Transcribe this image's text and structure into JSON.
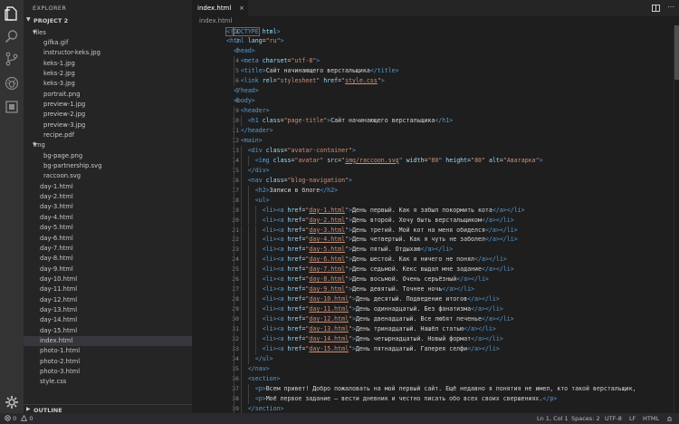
{
  "sidebar": {
    "title": "EXPLORER",
    "project": "PROJECT 2",
    "outline": "OUTLINE",
    "tree": [
      {
        "label": "files",
        "kind": "folder"
      },
      {
        "label": "gifka.gif",
        "kind": "file"
      },
      {
        "label": "instructor-keks.jpg",
        "kind": "file"
      },
      {
        "label": "keks-1.jpg",
        "kind": "file"
      },
      {
        "label": "keks-2.jpg",
        "kind": "file"
      },
      {
        "label": "keks-3.jpg",
        "kind": "file"
      },
      {
        "label": "portrait.png",
        "kind": "file"
      },
      {
        "label": "preview-1.jpg",
        "kind": "file"
      },
      {
        "label": "preview-2.jpg",
        "kind": "file"
      },
      {
        "label": "preview-3.jpg",
        "kind": "file"
      },
      {
        "label": "recipe.pdf",
        "kind": "file"
      },
      {
        "label": "img",
        "kind": "folder"
      },
      {
        "label": "bg-page.png",
        "kind": "file"
      },
      {
        "label": "bg-partnership.svg",
        "kind": "file"
      },
      {
        "label": "raccoon.svg",
        "kind": "file"
      },
      {
        "label": "day-1.html",
        "kind": "root"
      },
      {
        "label": "day-2.html",
        "kind": "root"
      },
      {
        "label": "day-3.html",
        "kind": "root"
      },
      {
        "label": "day-4.html",
        "kind": "root"
      },
      {
        "label": "day-5.html",
        "kind": "root"
      },
      {
        "label": "day-6.html",
        "kind": "root"
      },
      {
        "label": "day-7.html",
        "kind": "root"
      },
      {
        "label": "day-8.html",
        "kind": "root"
      },
      {
        "label": "day-9.html",
        "kind": "root"
      },
      {
        "label": "day-10.html",
        "kind": "root"
      },
      {
        "label": "day-11.html",
        "kind": "root"
      },
      {
        "label": "day-12.html",
        "kind": "root"
      },
      {
        "label": "day-13.html",
        "kind": "root"
      },
      {
        "label": "day-14.html",
        "kind": "root"
      },
      {
        "label": "day-15.html",
        "kind": "root"
      },
      {
        "label": "index.html",
        "kind": "root",
        "selected": true
      },
      {
        "label": "photo-1.html",
        "kind": "root"
      },
      {
        "label": "photo-2.html",
        "kind": "root"
      },
      {
        "label": "photo-3.html",
        "kind": "root"
      },
      {
        "label": "style.css",
        "kind": "root"
      }
    ]
  },
  "editor": {
    "tab_label": "index.html",
    "close_glyph": "×",
    "breadcrumb": "index.html",
    "lines": [
      [
        [
          "<!",
          "t"
        ],
        [
          "DOCTYPE",
          "t"
        ],
        [
          " html",
          "a"
        ],
        [
          ">",
          "t"
        ]
      ],
      [
        [
          "<html",
          "t"
        ],
        [
          " lang",
          "a"
        ],
        [
          "=",
          "p"
        ],
        [
          "\"ru\"",
          "s"
        ],
        [
          ">",
          "t"
        ]
      ],
      [
        [
          "  "
        ],
        [
          "<head>",
          "t"
        ]
      ],
      [
        [
          "    "
        ],
        [
          "<meta",
          "t"
        ],
        [
          " charset",
          "a"
        ],
        [
          "=",
          "p"
        ],
        [
          "\"utf-8\"",
          "s"
        ],
        [
          ">",
          "t"
        ]
      ],
      [
        [
          "    "
        ],
        [
          "<title>",
          "t"
        ],
        [
          "Сайт начинающего верстальщика",
          "p"
        ],
        [
          "</title>",
          "t"
        ]
      ],
      [
        [
          "    "
        ],
        [
          "<link",
          "t"
        ],
        [
          " rel",
          "a"
        ],
        [
          "=",
          "p"
        ],
        [
          "\"stylesheet\"",
          "s"
        ],
        [
          " href",
          "a"
        ],
        [
          "=",
          "p"
        ],
        [
          "\"",
          "s"
        ],
        [
          "style.css",
          "u"
        ],
        [
          "\"",
          "s"
        ],
        [
          ">",
          "t"
        ]
      ],
      [
        [
          "  "
        ],
        [
          "</head>",
          "t"
        ]
      ],
      [
        [
          "  "
        ],
        [
          "<body>",
          "t"
        ]
      ],
      [
        [
          "    "
        ],
        [
          "<header>",
          "t"
        ]
      ],
      [
        [
          "      "
        ],
        [
          "<h1",
          "t"
        ],
        [
          " class",
          "a"
        ],
        [
          "=",
          "p"
        ],
        [
          "\"page-title\"",
          "s"
        ],
        [
          ">",
          "t"
        ],
        [
          "Сайт начинающего верстальщика",
          "p"
        ],
        [
          "</h1>",
          "t"
        ]
      ],
      [
        [
          "    "
        ],
        [
          "</header>",
          "t"
        ]
      ],
      [
        [
          "    "
        ],
        [
          "<main>",
          "t"
        ]
      ],
      [
        [
          "      "
        ],
        [
          "<div",
          "t"
        ],
        [
          " class",
          "a"
        ],
        [
          "=",
          "p"
        ],
        [
          "\"avatar-container\"",
          "s"
        ],
        [
          ">",
          "t"
        ]
      ],
      [
        [
          "        "
        ],
        [
          "<img",
          "t"
        ],
        [
          " class",
          "a"
        ],
        [
          "=",
          "p"
        ],
        [
          "\"avatar\"",
          "s"
        ],
        [
          " src",
          "a"
        ],
        [
          "=",
          "p"
        ],
        [
          "\"",
          "s"
        ],
        [
          "img/raccoon.svg",
          "u"
        ],
        [
          "\"",
          "s"
        ],
        [
          " width",
          "a"
        ],
        [
          "=",
          "p"
        ],
        [
          "\"80\"",
          "s"
        ],
        [
          " height",
          "a"
        ],
        [
          "=",
          "p"
        ],
        [
          "\"80\"",
          "s"
        ],
        [
          " alt",
          "a"
        ],
        [
          "=",
          "p"
        ],
        [
          "\"Аватарка\"",
          "s"
        ],
        [
          ">",
          "t"
        ]
      ],
      [
        [
          "      "
        ],
        [
          "</div>",
          "t"
        ]
      ],
      [
        [
          "      "
        ],
        [
          "<nav",
          "t"
        ],
        [
          " class",
          "a"
        ],
        [
          "=",
          "p"
        ],
        [
          "\"blog-navigation\"",
          "s"
        ],
        [
          ">",
          "t"
        ]
      ],
      [
        [
          "        "
        ],
        [
          "<h2>",
          "t"
        ],
        [
          "Записи в блоге",
          "p"
        ],
        [
          "</h2>",
          "t"
        ]
      ],
      [
        [
          "        "
        ],
        [
          "<ul>",
          "t"
        ]
      ],
      [
        [
          "          "
        ],
        [
          "<li>",
          "t"
        ],
        [
          "<a",
          "t"
        ],
        [
          " href",
          "a"
        ],
        [
          "=",
          "p"
        ],
        [
          "\"",
          "s"
        ],
        [
          "day-1.html",
          "u"
        ],
        [
          "\"",
          "s"
        ],
        [
          ">",
          "t"
        ],
        [
          "День первый. Как я забыл покормить кота",
          "p"
        ],
        [
          "</a></li>",
          "t"
        ]
      ],
      [
        [
          "          "
        ],
        [
          "<li>",
          "t"
        ],
        [
          "<a",
          "t"
        ],
        [
          " href",
          "a"
        ],
        [
          "=",
          "p"
        ],
        [
          "\"",
          "s"
        ],
        [
          "day-2.html",
          "u"
        ],
        [
          "\"",
          "s"
        ],
        [
          ">",
          "t"
        ],
        [
          "День второй. Хочу быть верстальщиком",
          "p"
        ],
        [
          "</a></li>",
          "t"
        ]
      ],
      [
        [
          "          "
        ],
        [
          "<li>",
          "t"
        ],
        [
          "<a",
          "t"
        ],
        [
          " href",
          "a"
        ],
        [
          "=",
          "p"
        ],
        [
          "\"",
          "s"
        ],
        [
          "day-3.html",
          "u"
        ],
        [
          "\"",
          "s"
        ],
        [
          ">",
          "t"
        ],
        [
          "День третий. Мой кот на меня обиделся",
          "p"
        ],
        [
          "</a></li>",
          "t"
        ]
      ],
      [
        [
          "          "
        ],
        [
          "<li>",
          "t"
        ],
        [
          "<a",
          "t"
        ],
        [
          " href",
          "a"
        ],
        [
          "=",
          "p"
        ],
        [
          "\"",
          "s"
        ],
        [
          "day-4.html",
          "u"
        ],
        [
          "\"",
          "s"
        ],
        [
          ">",
          "t"
        ],
        [
          "День четвертый. Как я чуть не заболел",
          "p"
        ],
        [
          "</a></li>",
          "t"
        ]
      ],
      [
        [
          "          "
        ],
        [
          "<li>",
          "t"
        ],
        [
          "<a",
          "t"
        ],
        [
          " href",
          "a"
        ],
        [
          "=",
          "p"
        ],
        [
          "\"",
          "s"
        ],
        [
          "day-5.html",
          "u"
        ],
        [
          "\"",
          "s"
        ],
        [
          ">",
          "t"
        ],
        [
          "День пятый. Отдыхаю",
          "p"
        ],
        [
          "</a></li>",
          "t"
        ]
      ],
      [
        [
          "          "
        ],
        [
          "<li>",
          "t"
        ],
        [
          "<a",
          "t"
        ],
        [
          " href",
          "a"
        ],
        [
          "=",
          "p"
        ],
        [
          "\"",
          "s"
        ],
        [
          "day-6.html",
          "u"
        ],
        [
          "\"",
          "s"
        ],
        [
          ">",
          "t"
        ],
        [
          "День шестой. Как я ничего не понял",
          "p"
        ],
        [
          "</a></li>",
          "t"
        ]
      ],
      [
        [
          "          "
        ],
        [
          "<li>",
          "t"
        ],
        [
          "<a",
          "t"
        ],
        [
          " href",
          "a"
        ],
        [
          "=",
          "p"
        ],
        [
          "\"",
          "s"
        ],
        [
          "day-7.html",
          "u"
        ],
        [
          "\"",
          "s"
        ],
        [
          ">",
          "t"
        ],
        [
          "День седьмой. Кекс выдал мне задание",
          "p"
        ],
        [
          "</a></li>",
          "t"
        ]
      ],
      [
        [
          "          "
        ],
        [
          "<li>",
          "t"
        ],
        [
          "<a",
          "t"
        ],
        [
          " href",
          "a"
        ],
        [
          "=",
          "p"
        ],
        [
          "\"",
          "s"
        ],
        [
          "day-8.html",
          "u"
        ],
        [
          "\"",
          "s"
        ],
        [
          ">",
          "t"
        ],
        [
          "День восьмой. Очень серьёзный",
          "p"
        ],
        [
          "</a></li>",
          "t"
        ]
      ],
      [
        [
          "          "
        ],
        [
          "<li>",
          "t"
        ],
        [
          "<a",
          "t"
        ],
        [
          " href",
          "a"
        ],
        [
          "=",
          "p"
        ],
        [
          "\"",
          "s"
        ],
        [
          "day-9.html",
          "u"
        ],
        [
          "\"",
          "s"
        ],
        [
          ">",
          "t"
        ],
        [
          "День девятый. Точнее ночь",
          "p"
        ],
        [
          "</a></li>",
          "t"
        ]
      ],
      [
        [
          "          "
        ],
        [
          "<li>",
          "t"
        ],
        [
          "<a",
          "t"
        ],
        [
          " href",
          "a"
        ],
        [
          "=",
          "p"
        ],
        [
          "\"",
          "s"
        ],
        [
          "day-10.html",
          "u"
        ],
        [
          "\"",
          "s"
        ],
        [
          ">",
          "t"
        ],
        [
          "День десятый. Подведение итогов",
          "p"
        ],
        [
          "</a></li>",
          "t"
        ]
      ],
      [
        [
          "          "
        ],
        [
          "<li>",
          "t"
        ],
        [
          "<a",
          "t"
        ],
        [
          " href",
          "a"
        ],
        [
          "=",
          "p"
        ],
        [
          "\"",
          "s"
        ],
        [
          "day-11.html",
          "u"
        ],
        [
          "\"",
          "s"
        ],
        [
          ">",
          "t"
        ],
        [
          "День одиннадцатый. Без фанатизма",
          "p"
        ],
        [
          "</a></li>",
          "t"
        ]
      ],
      [
        [
          "          "
        ],
        [
          "<li>",
          "t"
        ],
        [
          "<a",
          "t"
        ],
        [
          " href",
          "a"
        ],
        [
          "=",
          "p"
        ],
        [
          "\"",
          "s"
        ],
        [
          "day-12.html",
          "u"
        ],
        [
          "\"",
          "s"
        ],
        [
          ">",
          "t"
        ],
        [
          "День двенадцатый. Все любят печенье",
          "p"
        ],
        [
          "</a></li>",
          "t"
        ]
      ],
      [
        [
          "          "
        ],
        [
          "<li>",
          "t"
        ],
        [
          "<a",
          "t"
        ],
        [
          " href",
          "a"
        ],
        [
          "=",
          "p"
        ],
        [
          "\"",
          "s"
        ],
        [
          "day-13.html",
          "u"
        ],
        [
          "\"",
          "s"
        ],
        [
          ">",
          "t"
        ],
        [
          "День тринадцатый. Нашёл статью",
          "p"
        ],
        [
          "</a></li>",
          "t"
        ]
      ],
      [
        [
          "          "
        ],
        [
          "<li>",
          "t"
        ],
        [
          "<a",
          "t"
        ],
        [
          " href",
          "a"
        ],
        [
          "=",
          "p"
        ],
        [
          "\"",
          "s"
        ],
        [
          "day-14.html",
          "u"
        ],
        [
          "\"",
          "s"
        ],
        [
          ">",
          "t"
        ],
        [
          "День четырнадцатый. Новый формат",
          "p"
        ],
        [
          "</a></li>",
          "t"
        ]
      ],
      [
        [
          "          "
        ],
        [
          "<li>",
          "t"
        ],
        [
          "<a",
          "t"
        ],
        [
          " href",
          "a"
        ],
        [
          "=",
          "p"
        ],
        [
          "\"",
          "s"
        ],
        [
          "day-15.html",
          "u"
        ],
        [
          "\"",
          "s"
        ],
        [
          ">",
          "t"
        ],
        [
          "День пятнадцатый. Галерея селфи",
          "p"
        ],
        [
          "</a></li>",
          "t"
        ]
      ],
      [
        [
          "        "
        ],
        [
          "</ul>",
          "t"
        ]
      ],
      [
        [
          "      "
        ],
        [
          "</nav>",
          "t"
        ]
      ],
      [
        [
          "      "
        ],
        [
          "<section>",
          "t"
        ]
      ],
      [
        [
          "        "
        ],
        [
          "<p>",
          "t"
        ],
        [
          "Всем привет! Добро пожаловать на мой первый сайт. Ещё недавно я понятия не имел, кто такой верстальщик,",
          "p"
        ]
      ],
      [
        [
          "        "
        ],
        [
          "<p>",
          "t"
        ],
        [
          "Моё первое задание — вести дневник и честно писать обо всех своих свершениях.",
          "p"
        ],
        [
          "</p>",
          "t"
        ]
      ],
      [
        [
          "      "
        ],
        [
          "</section>",
          "t"
        ]
      ]
    ]
  },
  "status": {
    "errors": "0",
    "warnings": "0",
    "position": "Ln 1, Col 1",
    "spaces": "Spaces: 2",
    "encoding": "UTF-8",
    "eol": "LF",
    "language": "HTML"
  },
  "colors": {
    "tag": "#569cd6",
    "attr": "#9cdcfe",
    "string": "#ce9178",
    "plain": "#d4d4d4",
    "link": "#ce9178"
  }
}
